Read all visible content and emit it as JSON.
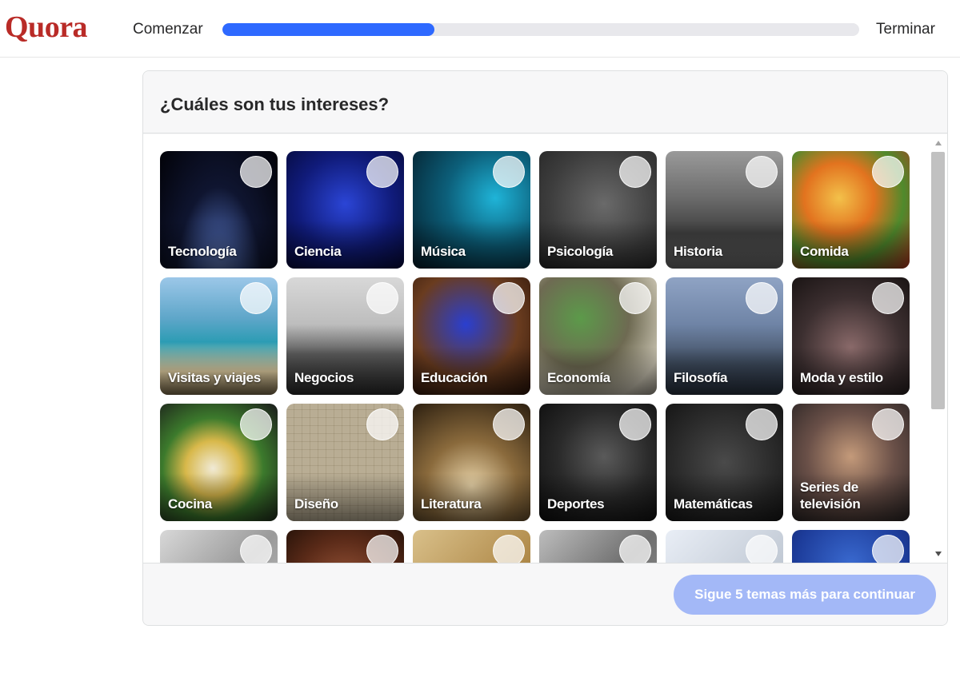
{
  "header": {
    "logo": "Quora",
    "progress_start_label": "Comenzar",
    "progress_end_label": "Terminar",
    "progress_fraction": 0.333,
    "progress_color": "#2e69ff",
    "brand_color": "#b92b27"
  },
  "card": {
    "title": "¿Cuáles son tus intereses?",
    "continue_label": "Sigue 5 temas más para continuar"
  },
  "topics": [
    {
      "label": "Tecnología",
      "bg": "bg-tecnologia",
      "selected": false
    },
    {
      "label": "Ciencia",
      "bg": "bg-ciencia",
      "selected": false
    },
    {
      "label": "Música",
      "bg": "bg-musica",
      "selected": false
    },
    {
      "label": "Psicología",
      "bg": "bg-psicologia",
      "selected": false
    },
    {
      "label": "Historia",
      "bg": "bg-historia",
      "selected": false
    },
    {
      "label": "Comida",
      "bg": "bg-comida",
      "selected": false
    },
    {
      "label": "Visitas y viajes",
      "bg": "bg-viajes",
      "selected": false
    },
    {
      "label": "Negocios",
      "bg": "bg-negocios",
      "selected": false
    },
    {
      "label": "Educación",
      "bg": "bg-educacion",
      "selected": false
    },
    {
      "label": "Economía",
      "bg": "bg-economia",
      "selected": false
    },
    {
      "label": "Filosofía",
      "bg": "bg-filosofia",
      "selected": false
    },
    {
      "label": "Moda y estilo",
      "bg": "bg-moda",
      "selected": false
    },
    {
      "label": "Cocina",
      "bg": "bg-cocina",
      "selected": false
    },
    {
      "label": "Diseño",
      "bg": "bg-diseno",
      "selected": false
    },
    {
      "label": "Literatura",
      "bg": "bg-literatura",
      "selected": false
    },
    {
      "label": "Deportes",
      "bg": "bg-deportes",
      "selected": false
    },
    {
      "label": "Matemáticas",
      "bg": "bg-matematicas",
      "selected": false
    },
    {
      "label": "Series de televisión",
      "bg": "bg-series",
      "selected": false
    },
    {
      "label": "",
      "bg": "bg-r4-1",
      "selected": false
    },
    {
      "label": "",
      "bg": "bg-r4-2",
      "selected": false
    },
    {
      "label": "",
      "bg": "bg-r4-3",
      "selected": false
    },
    {
      "label": "",
      "bg": "bg-r4-4",
      "selected": false
    },
    {
      "label": "",
      "bg": "bg-r4-5",
      "selected": false
    },
    {
      "label": "",
      "bg": "bg-r4-6",
      "selected": false
    }
  ]
}
